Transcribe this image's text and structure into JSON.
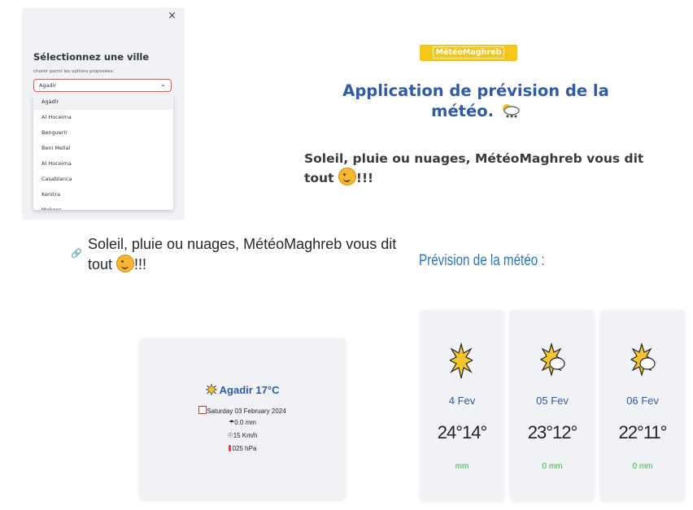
{
  "sidebar": {
    "close": "×",
    "title": "Sélectionnez une ville",
    "subtitle": "choisir parmi les options proposées:",
    "selected": "Agadir",
    "options": [
      "Agadir",
      "Al Hoceima",
      "Benguerir",
      "Beni Mellal",
      "Al Hoceima",
      "Casablanca",
      "Kenitra",
      "Meknes"
    ]
  },
  "header": {
    "logo": "MétéoMaghreb",
    "title": "Application de prévision de la météo.",
    "tagline_top": "Soleil, pluie ou nuages, MétéoMaghreb vous dit tout",
    "tagline_suffix": "!!!"
  },
  "tagline_bottom": "Soleil, pluie ou nuages, MétéoMaghreb vous dit tout",
  "tagline_bottom_suffix": "!!!",
  "forecast_title": "Prévision de la météo :",
  "current": {
    "city": "Agadir 17°C",
    "date": "Saturday 03 February 2024",
    "rain": "0.0 mm",
    "wind": "15 Km/h",
    "pressure": "025 hPa"
  },
  "forecast": [
    {
      "date": "4 Fev",
      "temp": "24°14°",
      "rain": "mm",
      "icon": "sun-icon"
    },
    {
      "date": "05 Fev",
      "temp": "23°12°",
      "rain": "0 mm",
      "icon": "sun-cloud-icon"
    },
    {
      "date": "06 Fev",
      "temp": "22°11°",
      "rain": "0 mm",
      "icon": "sun-cloud-icon"
    }
  ],
  "colors": {
    "accent": "#ff4b4b",
    "title": "#2e5aa8",
    "logo": "#f5c518",
    "rain": "#3cb043"
  }
}
